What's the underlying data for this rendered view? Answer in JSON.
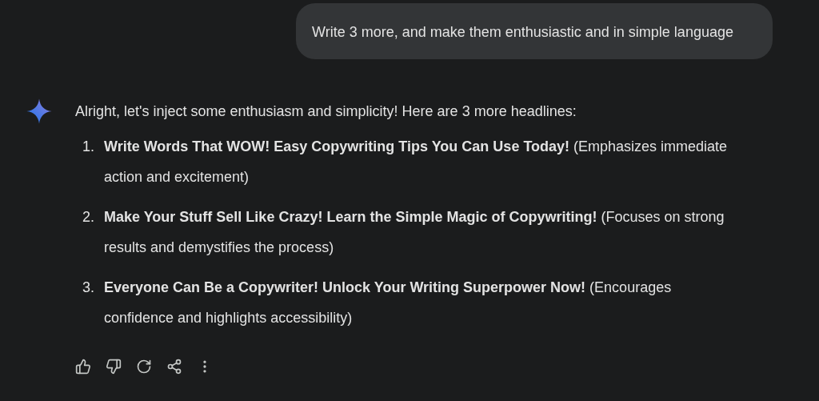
{
  "user_message": {
    "text": "Write 3 more, and make them enthusiastic and in simple language"
  },
  "response": {
    "intro": "Alright, let's inject some enthusiasm and simplicity! Here are 3 more headlines:",
    "items": [
      {
        "number": "1.",
        "text": "**Write Words That WOW! Easy Copywriting Tips You Can Use Today!** (Emphasizes immediate action and excitement)"
      },
      {
        "number": "2.",
        "text": "**Make Your Stuff Sell Like Crazy! Learn the Simple Magic of Copywriting!** (Focuses on strong results and demystifies the process)"
      },
      {
        "number": "3.",
        "text": "**Everyone Can Be a Copywriter! Unlock Your Writing Superpower Now!** (Encourages confidence and highlights accessibility)"
      }
    ]
  }
}
